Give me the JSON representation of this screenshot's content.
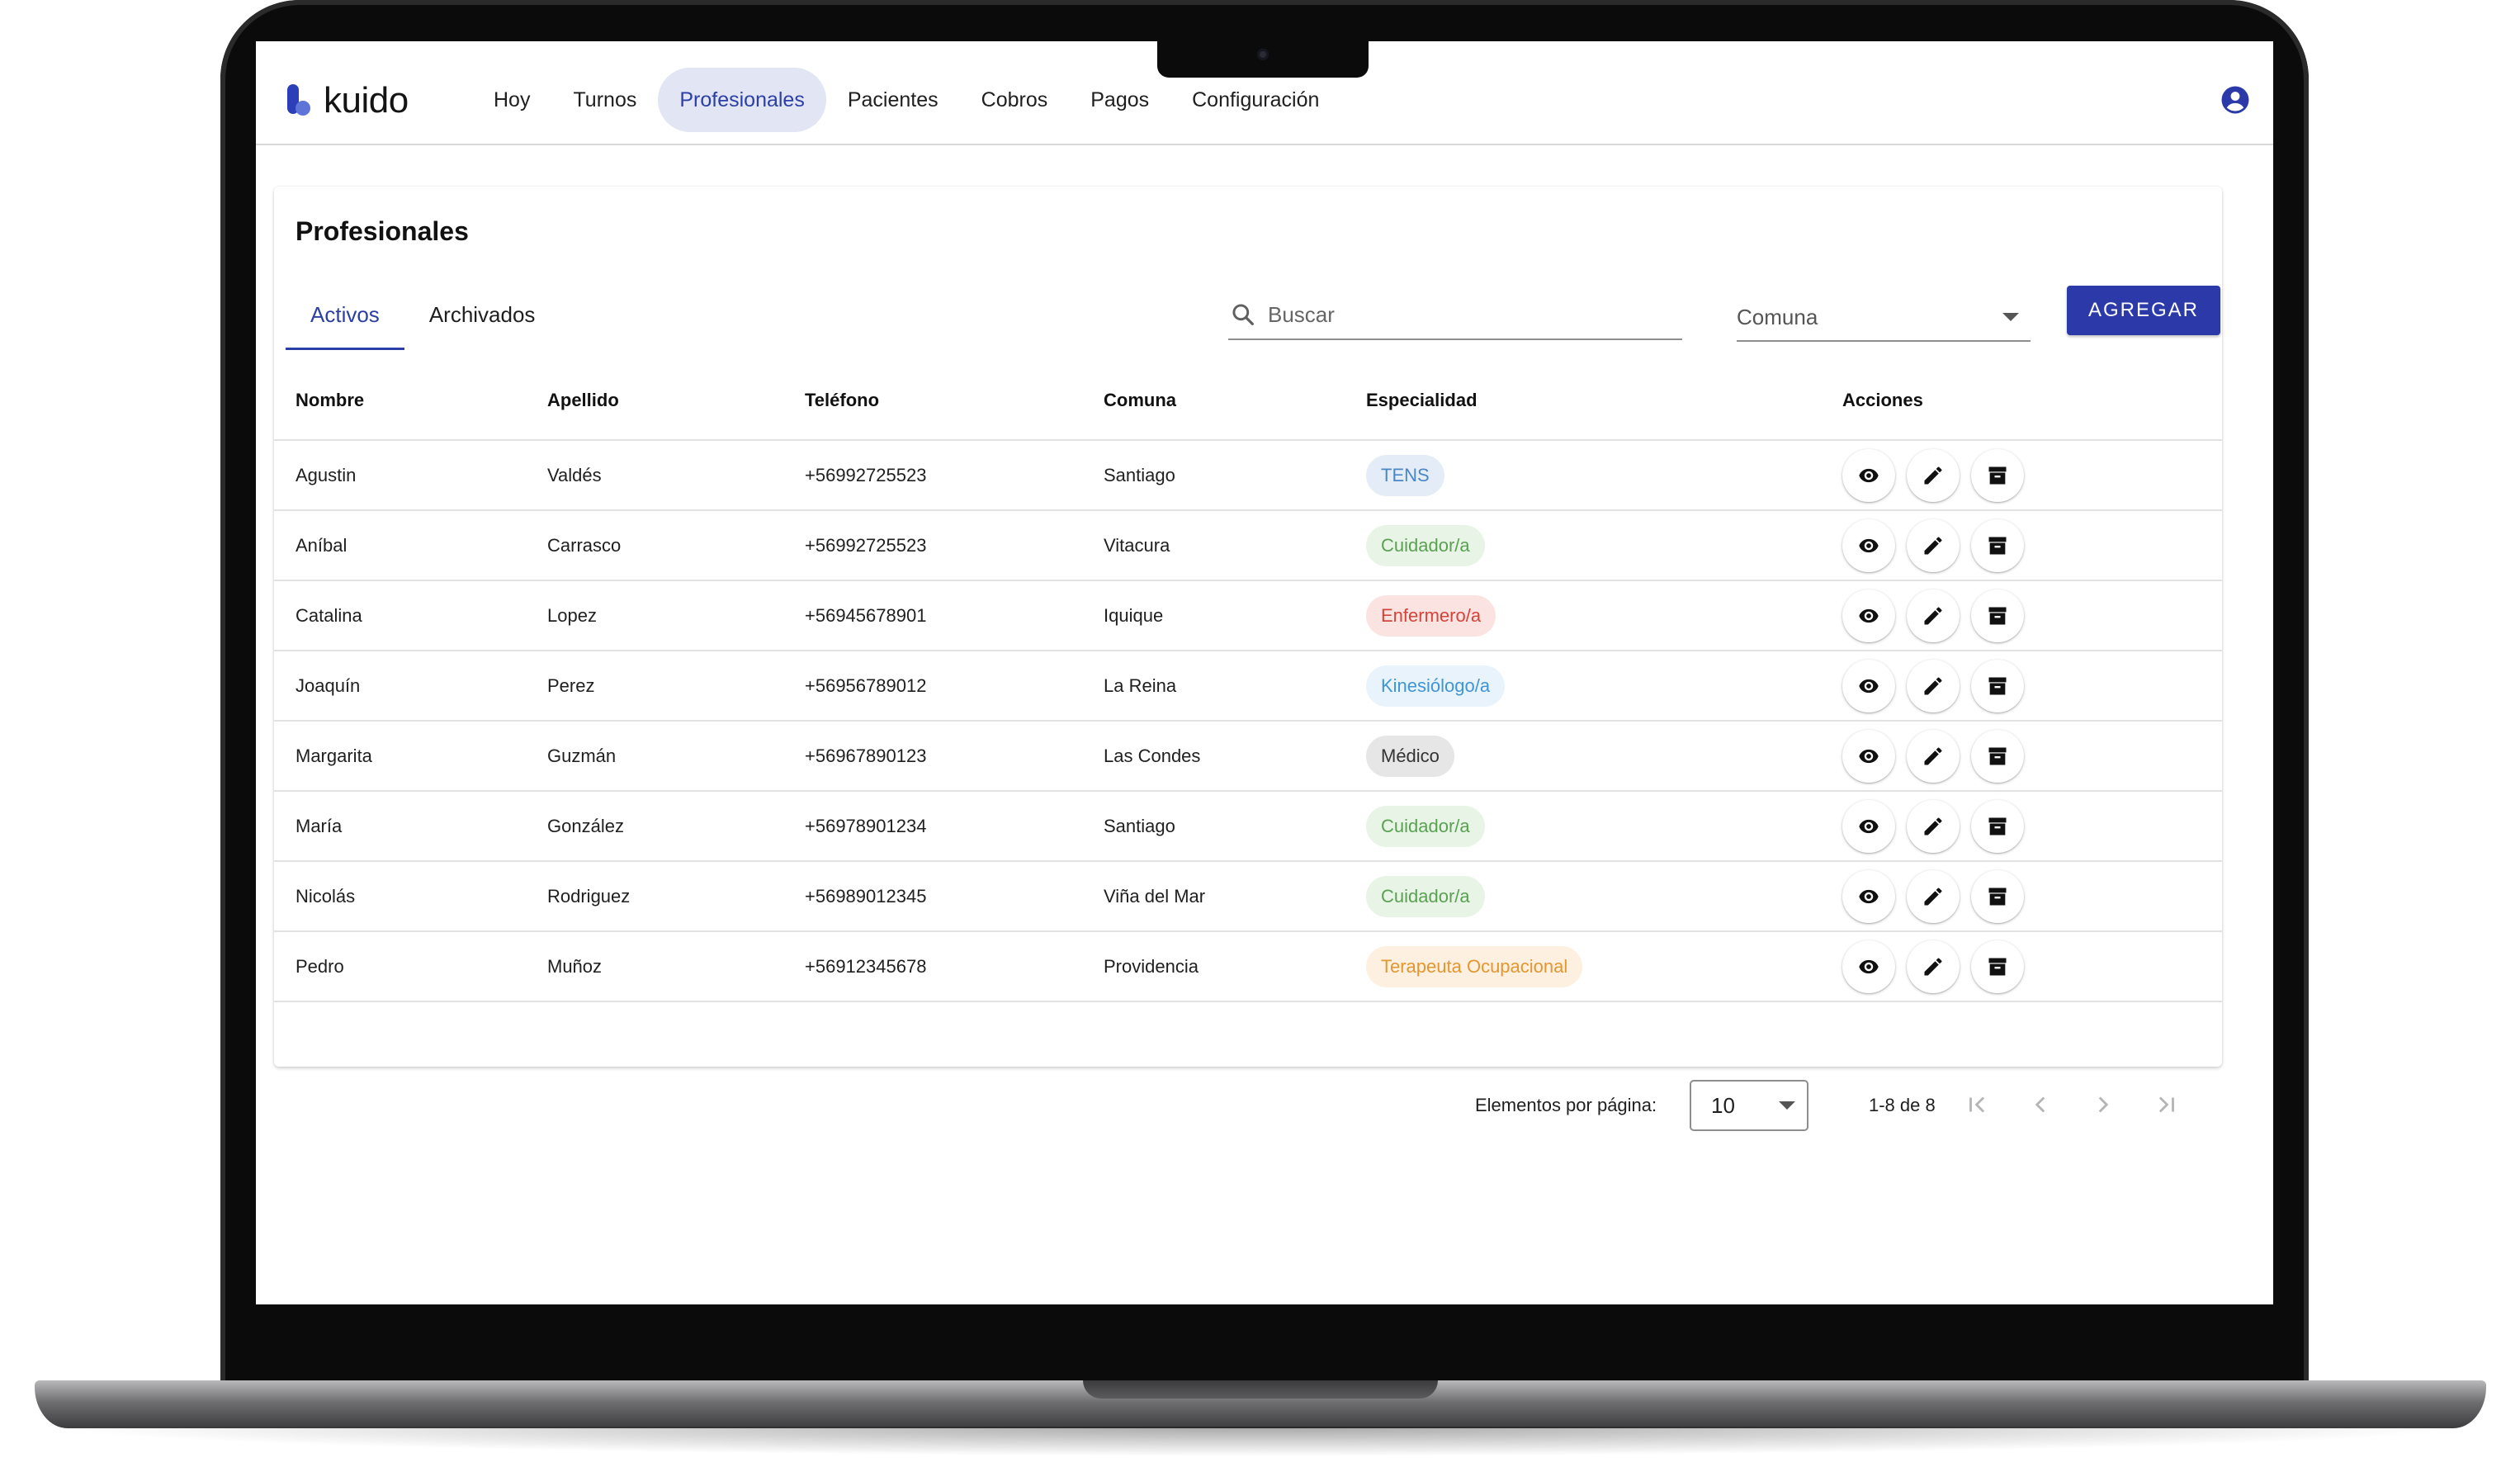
{
  "app": {
    "logo_text": "kuido"
  },
  "nav": {
    "items": [
      "Hoy",
      "Turnos",
      "Profesionales",
      "Pacientes",
      "Cobros",
      "Pagos",
      "Configuración"
    ],
    "active": "Profesionales"
  },
  "page": {
    "title": "Profesionales",
    "tabs": [
      "Activos",
      "Archivados"
    ],
    "active_tab": "Activos",
    "search_placeholder": "Buscar",
    "comuna_label": "Comuna",
    "add_label": "AGREGAR"
  },
  "table": {
    "headers": [
      "Nombre",
      "Apellido",
      "Teléfono",
      "Comuna",
      "Especialidad",
      "Acciones"
    ],
    "rows": [
      {
        "nombre": "Agustin",
        "apellido": "Valdés",
        "telefono": "+56992725523",
        "comuna": "Santiago",
        "especialidad": "TENS",
        "chip_bg": "#e4edf7",
        "chip_fg": "#4a86c8"
      },
      {
        "nombre": "Aníbal",
        "apellido": "Carrasco",
        "telefono": "+56992725523",
        "comuna": "Vitacura",
        "especialidad": "Cuidador/a",
        "chip_bg": "#e8f4e6",
        "chip_fg": "#5aa152"
      },
      {
        "nombre": "Catalina",
        "apellido": "Lopez",
        "telefono": "+56945678901",
        "comuna": "Iquique",
        "especialidad": "Enfermero/a",
        "chip_bg": "#fbe3e1",
        "chip_fg": "#d3443a"
      },
      {
        "nombre": "Joaquín",
        "apellido": "Perez",
        "telefono": "+56956789012",
        "comuna": "La Reina",
        "especialidad": "Kinesiólogo/a",
        "chip_bg": "#e8f3fb",
        "chip_fg": "#3f95d6"
      },
      {
        "nombre": "Margarita",
        "apellido": "Guzmán",
        "telefono": "+56967890123",
        "comuna": "Las Condes",
        "especialidad": "Médico",
        "chip_bg": "#e6e6e6",
        "chip_fg": "#333333"
      },
      {
        "nombre": "María",
        "apellido": "González",
        "telefono": "+56978901234",
        "comuna": "Santiago",
        "especialidad": "Cuidador/a",
        "chip_bg": "#e8f4e6",
        "chip_fg": "#5aa152"
      },
      {
        "nombre": "Nicolás",
        "apellido": "Rodriguez",
        "telefono": "+56989012345",
        "comuna": "Viña del Mar",
        "especialidad": "Cuidador/a",
        "chip_bg": "#e8f4e6",
        "chip_fg": "#5aa152"
      },
      {
        "nombre": "Pedro",
        "apellido": "Muñoz",
        "telefono": "+56912345678",
        "comuna": "Providencia",
        "especialidad": "Terapeuta Ocupacional",
        "chip_bg": "#fdf0e0",
        "chip_fg": "#e5962f"
      }
    ],
    "row_actions": [
      "eye-icon",
      "pencil-icon",
      "archive-icon"
    ]
  },
  "pagination": {
    "label": "Elementos por página:",
    "page_size": "10",
    "range": "1-8 de 8"
  },
  "colors": {
    "accent": "#2b3aa8",
    "nav_active_bg": "#e1e5f4"
  }
}
